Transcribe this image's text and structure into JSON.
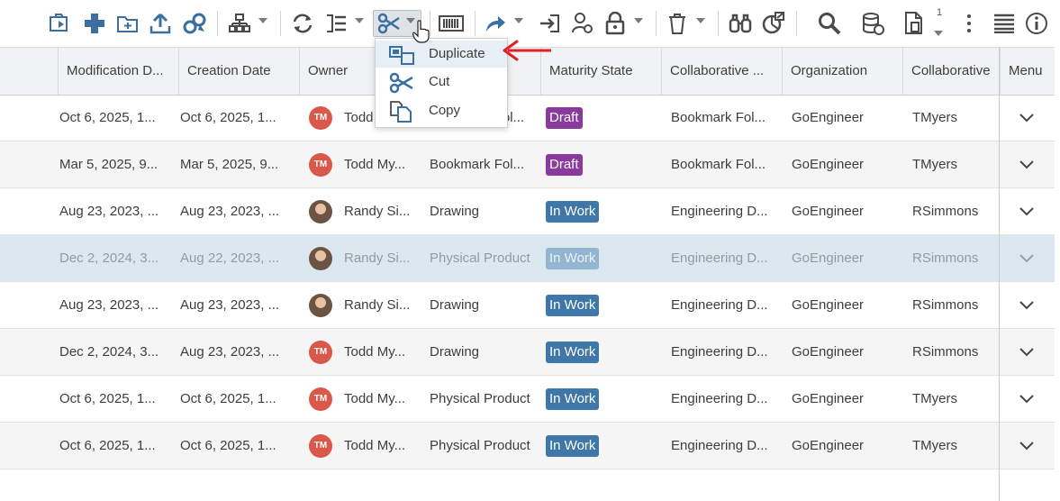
{
  "toolbar": {
    "icons": [
      "import-icon",
      "add-icon",
      "new-folder-icon",
      "upload-icon",
      "link-icon",
      "structure-icon",
      "refresh-icon",
      "attributes-icon",
      "scissors-icon",
      "barcode-icon",
      "share-icon",
      "login-icon",
      "user-settings-icon",
      "lock-icon",
      "trash-icon",
      "binoculars-icon",
      "pie-export-icon",
      "search-icon",
      "database-icon",
      "document-icon",
      "more-icon",
      "list-icon",
      "info-icon"
    ],
    "document_count": "1"
  },
  "dropdown": {
    "items": [
      {
        "label": "Duplicate",
        "icon": "duplicate-icon"
      },
      {
        "label": "Cut",
        "icon": "cut-icon"
      },
      {
        "label": "Copy",
        "icon": "copy-icon"
      }
    ]
  },
  "columns": [
    "Modification D...",
    "Creation Date",
    "Owner",
    "",
    "Maturity State",
    "Collaborative ...",
    "Organization",
    "Collaborative",
    "Menu"
  ],
  "colors": {
    "draft": "#8a3a9c",
    "in_work": "#3f78a8",
    "avatar": "#d9584a",
    "selected_row": "#dce8f0",
    "arrow": "#e0202a"
  },
  "rows": [
    {
      "mod": "Oct 6, 2025, 1...",
      "created": "Oct 6, 2025, 1...",
      "initials": "TM",
      "owner": "Todd My...",
      "type": "Bookmark Fol...",
      "state": "Draft",
      "collab_space": "Bookmark Fol...",
      "org": "GoEngineer",
      "collab": "TMyers"
    },
    {
      "mod": "Mar 5, 2025, 9...",
      "created": "Mar 5, 2025, 9...",
      "initials": "TM",
      "owner": "Todd My...",
      "type": "Bookmark Fol...",
      "state": "Draft",
      "collab_space": "Bookmark Fol...",
      "org": "GoEngineer",
      "collab": "TMyers"
    },
    {
      "mod": "Aug 23, 2023, ...",
      "created": "Aug 23, 2023, ...",
      "initials": "",
      "owner": "Randy Si...",
      "type": "Drawing",
      "state": "In Work",
      "collab_space": "Engineering D...",
      "org": "GoEngineer",
      "collab": "RSimmons"
    },
    {
      "mod": "Dec 2, 2024, 3...",
      "created": "Aug 22, 2023, ...",
      "initials": "",
      "owner": "Randy Si...",
      "type": "Physical Product",
      "state": "In Work",
      "collab_space": "Engineering D...",
      "org": "GoEngineer",
      "collab": "RSimmons"
    },
    {
      "mod": "Aug 23, 2023, ...",
      "created": "Aug 23, 2023, ...",
      "initials": "",
      "owner": "Randy Si...",
      "type": "Drawing",
      "state": "In Work",
      "collab_space": "Engineering D...",
      "org": "GoEngineer",
      "collab": "RSimmons"
    },
    {
      "mod": "Dec 2, 2024, 3...",
      "created": "Aug 23, 2023, ...",
      "initials": "TM",
      "owner": "Todd My...",
      "type": "Drawing",
      "state": "In Work",
      "collab_space": "Engineering D...",
      "org": "GoEngineer",
      "collab": "RSimmons"
    },
    {
      "mod": "Oct 6, 2025, 1...",
      "created": "Oct 6, 2025, 1...",
      "initials": "TM",
      "owner": "Todd My...",
      "type": "Physical Product",
      "state": "In Work",
      "collab_space": "Engineering D...",
      "org": "GoEngineer",
      "collab": "TMyers"
    },
    {
      "mod": "Oct 6, 2025, 1...",
      "created": "Oct 6, 2025, 1...",
      "initials": "TM",
      "owner": "Todd My...",
      "type": "Physical Product",
      "state": "In Work",
      "collab_space": "Engineering D...",
      "org": "GoEngineer",
      "collab": "TMyers"
    }
  ]
}
